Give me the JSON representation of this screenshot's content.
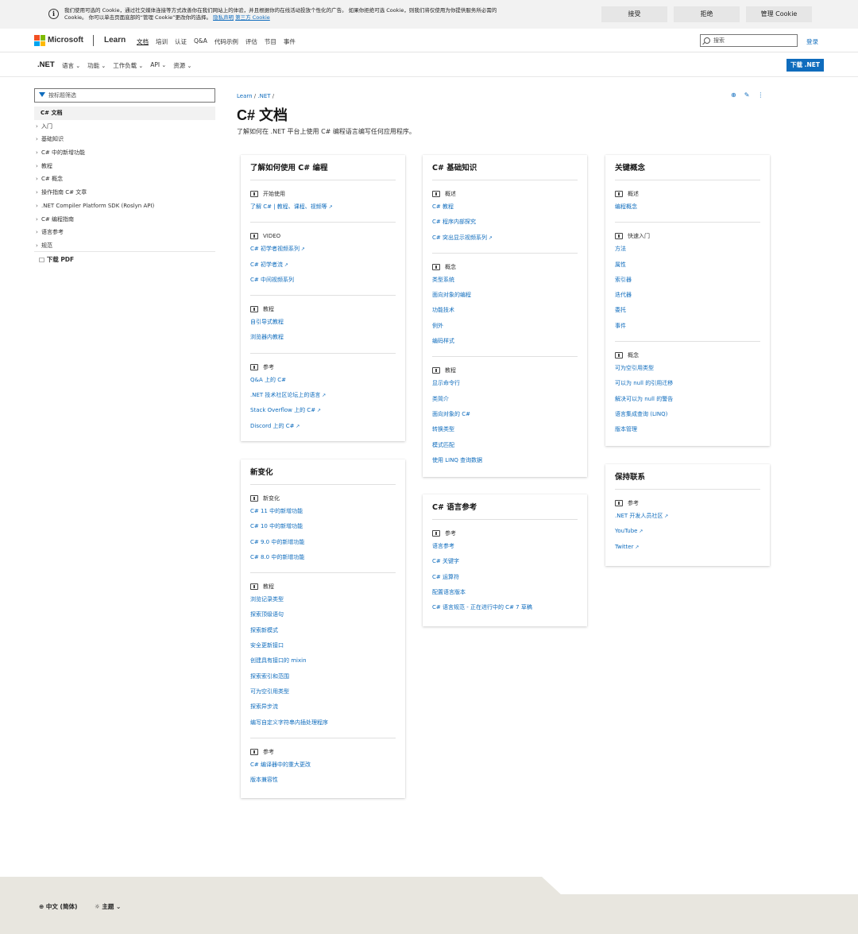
{
  "cookie": {
    "line1": "我们使用可选的 Cookie，通过社交媒体连接等方式改善你在我们网站上的体验，并且根据你的在线活动投放个性化的广告。 如果你拒绝可选 Cookie，则我们将仅使用为你提供服务所必需的",
    "line2": "Cookie。 你可以单击页面底部的“管理 Cookie”更改你的选择。",
    "privacy": "隐私声明",
    "thirdparty": "第三方 Cookie",
    "accept": "接受",
    "reject": "拒绝",
    "manage": "管理 Cookie"
  },
  "header": {
    "brand": "Microsoft",
    "learn": "Learn",
    "nav": [
      "文档",
      "培训",
      "认证",
      "Q&A",
      "代码示例",
      "评估",
      "节目",
      "事件"
    ],
    "search_placeholder": "搜索",
    "signin": "登录"
  },
  "subheader": {
    "product": ".NET",
    "nav": [
      "语言",
      "功能",
      "工作负载",
      "API",
      "资源"
    ],
    "download": "下载 .NET"
  },
  "sidebar": {
    "filter_placeholder": "按标题筛选",
    "items": [
      "C# 文档",
      "入门",
      "基础知识",
      "C# 中的新增功能",
      "教程",
      "C# 概念",
      "操作指南 C# 文章",
      ".NET Compiler Platform SDK (Roslyn API)",
      "C# 编程指南",
      "语言参考",
      "规范"
    ],
    "pdf": "下载 PDF"
  },
  "page": {
    "breadcrumb": [
      "Learn",
      ".NET"
    ],
    "title": "C# 文档",
    "description": "了解如何在 .NET 平台上使用 C# 编程语言编写任何应用程序。"
  },
  "cards": {
    "learn": {
      "title": "了解如何使用 C# 编程",
      "sections": [
        {
          "heading": "开始使用",
          "links": [
            "了解 C# | 教程、课程、视频等"
          ]
        },
        {
          "heading": "VIDEO",
          "links": [
            "C# 初学者视频系列",
            "C# 初学者流",
            "C# 中间视频系列"
          ]
        },
        {
          "heading": "教程",
          "links": [
            "自引导式教程",
            "浏览器内教程"
          ]
        },
        {
          "heading": "参考",
          "links": [
            "Q&A 上的 C#",
            ".NET 技术社区论坛上的语言",
            "Stack Overflow 上的 C#",
            "Discord 上的 C#"
          ]
        }
      ]
    },
    "whatsnew": {
      "title": "新变化",
      "sections": [
        {
          "heading": "新变化",
          "links": [
            "C# 11 中的新增功能",
            "C# 10 中的新增功能",
            "C# 9.0 中的新增功能",
            "C# 8.0 中的新增功能"
          ]
        },
        {
          "heading": "教程",
          "links": [
            "浏览记录类型",
            "探索顶级语句",
            "探索新模式",
            "安全更新接口",
            "创建具有接口的 mixin",
            "探索索引和范围",
            "可为空引用类型",
            "探索异步流",
            "编写自定义字符串内插处理程序"
          ]
        },
        {
          "heading": "参考",
          "links": [
            "C# 编译器中的重大更改",
            "版本兼容性"
          ]
        }
      ]
    },
    "basics": {
      "title": "C# 基础知识",
      "sections": [
        {
          "heading": "概述",
          "links": [
            "C# 教程",
            "C# 程序内部探究",
            "C# 突出显示视频系列"
          ]
        },
        {
          "heading": "概念",
          "links": [
            "类型系统",
            "面向对象的编程",
            "功能技术",
            "例外",
            "编码样式"
          ]
        },
        {
          "heading": "教程",
          "links": [
            "显示命令行",
            "类简介",
            "面向对象的 C#",
            "转换类型",
            "模式匹配",
            "使用 LINQ 查询数据"
          ]
        }
      ]
    },
    "langref": {
      "title": "C# 语言参考",
      "sections": [
        {
          "heading": "参考",
          "links": [
            "语言参考",
            "C# 关键字",
            "C# 运算符",
            "配置语言版本",
            "C# 语言规范 - 正在进行中的 C# 7 草稿"
          ]
        }
      ]
    },
    "concepts": {
      "title": "关键概念",
      "sections": [
        {
          "heading": "概述",
          "links": [
            "编程概念"
          ]
        },
        {
          "heading": "快速入门",
          "links": [
            "方法",
            "属性",
            "索引器",
            "迭代器",
            "委托",
            "事件"
          ]
        },
        {
          "heading": "概念",
          "links": [
            "可为空引用类型",
            "可以为 null 的引用迁移",
            "解决可以为 null 的警告",
            "语言集成查询 (LINQ)",
            "版本管理"
          ]
        }
      ]
    },
    "connected": {
      "title": "保持联系",
      "sections": [
        {
          "heading": "参考",
          "links": [
            ".NET 开发人员社区",
            "YouTube",
            "Twitter"
          ]
        }
      ]
    }
  },
  "footer": {
    "language": "中文 (简体)",
    "theme": "主题"
  },
  "colors": {
    "accent": "#0f6cbd",
    "footer_bg": "#e8e6df"
  }
}
